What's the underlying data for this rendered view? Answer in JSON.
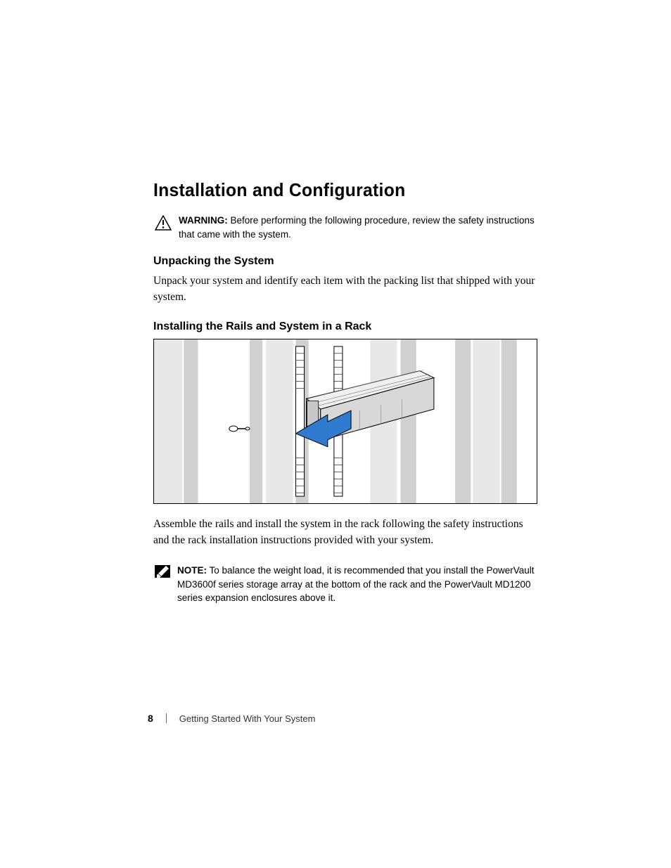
{
  "heading": "Installation and Configuration",
  "warning": {
    "label": "WARNING:",
    "text": "Before performing the following procedure, review the safety instructions that came with the system."
  },
  "section1": {
    "heading": "Unpacking the System",
    "body": "Unpack your system and identify each item with the packing list that shipped with your system."
  },
  "section2": {
    "heading": "Installing the Rails and System in a Rack",
    "body": "Assemble the rails and install the system in the rack following the safety instructions and the rack installation instructions provided with your system."
  },
  "note": {
    "label": "NOTE:",
    "text": "To balance the weight load, it is recommended that you install the PowerVault MD3600f series storage array at the bottom of the rack and the PowerVault MD1200 series expansion enclosures above it."
  },
  "footer": {
    "page_number": "8",
    "title": "Getting Started With Your System"
  }
}
